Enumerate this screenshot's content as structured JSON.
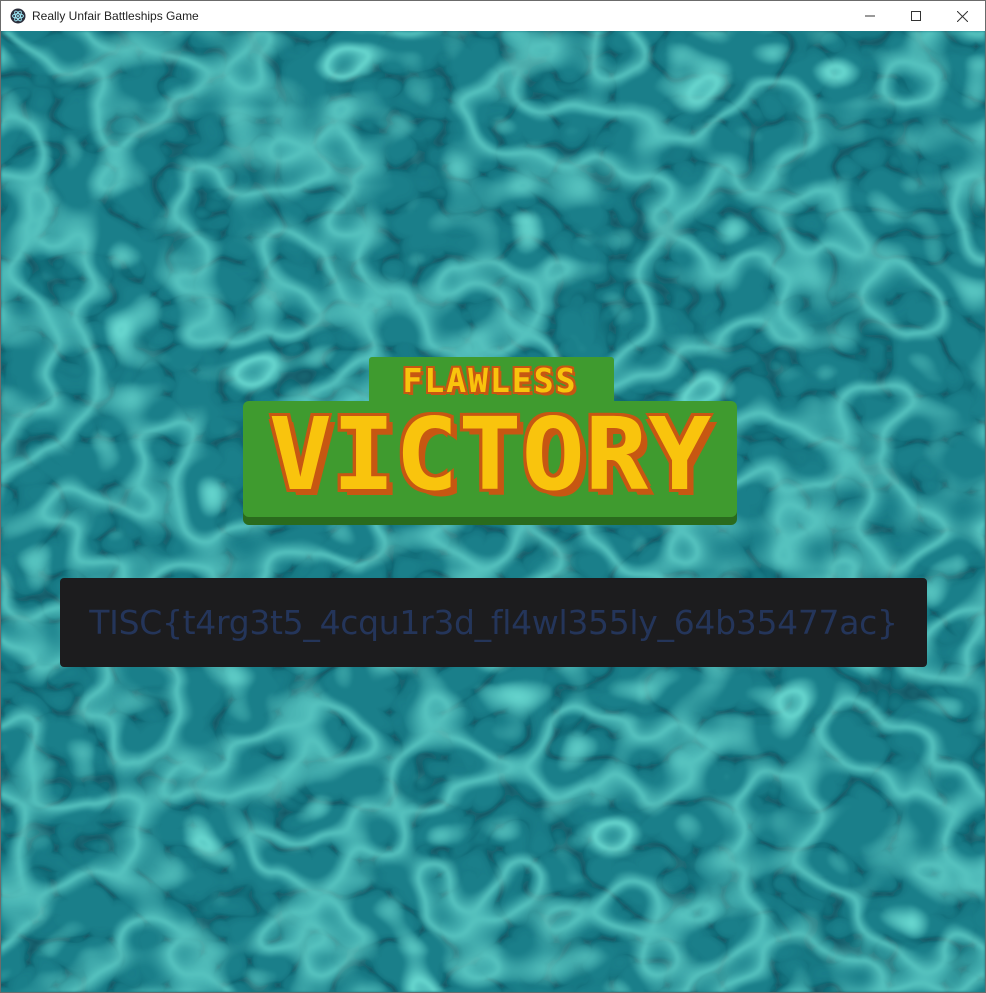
{
  "window": {
    "title": "Really Unfair Battleships Game",
    "icon": "electron-app-icon",
    "controls": [
      "minimize",
      "maximize",
      "close"
    ]
  },
  "game": {
    "background": "water-caustics",
    "victory": {
      "top_text": "FLAWLESS",
      "main_text": "VICTORY"
    },
    "flag": "TISC{t4rg3t5_4cqu1r3d_fl4wl355ly_64b35477ac}"
  },
  "colors": {
    "water": "#177380",
    "badge_green": "#3f9b2f",
    "badge_shadow": "#2a6b1d",
    "text_yellow": "#f9c40d",
    "text_outline": "#c75712",
    "flag_box": "#1c1c1e",
    "flag_text": "#24355a"
  }
}
